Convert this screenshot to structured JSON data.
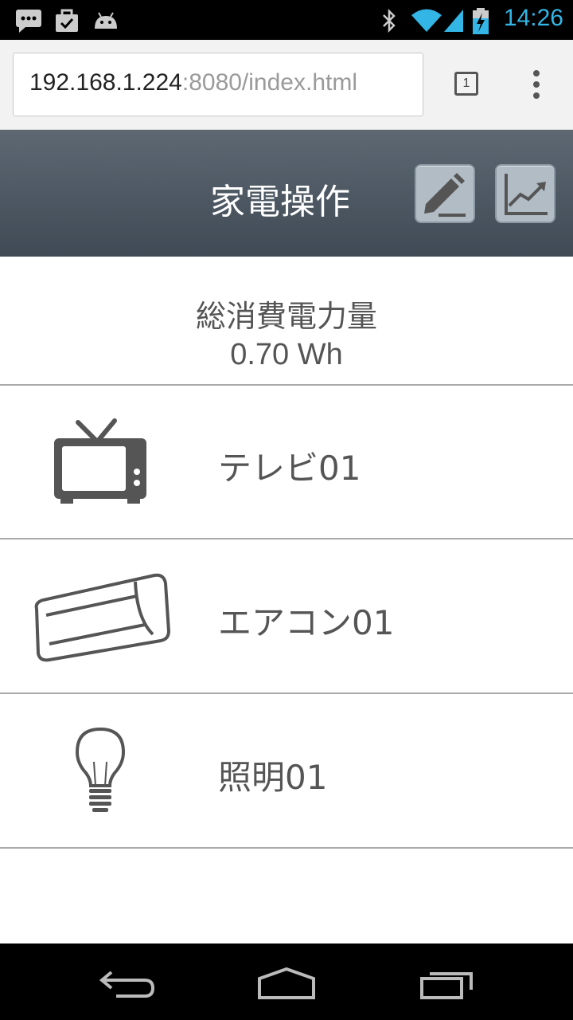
{
  "status_bar": {
    "time": "14:26"
  },
  "browser": {
    "url_host": "192.168.1.224",
    "url_path": ":8080/index.html",
    "tab_count": "1"
  },
  "header": {
    "title": "家電操作"
  },
  "summary": {
    "label": "総消費電力量",
    "value": "0.70 Wh"
  },
  "devices": [
    {
      "name": "テレビ01",
      "icon": "tv-icon"
    },
    {
      "name": "エアコン01",
      "icon": "air-conditioner-icon"
    },
    {
      "name": "照明01",
      "icon": "light-bulb-icon"
    }
  ],
  "colors": {
    "clock": "#33b5e5",
    "header_top": "#5d6873",
    "header_bottom": "#3f4a55",
    "icon_gray": "#555555"
  }
}
